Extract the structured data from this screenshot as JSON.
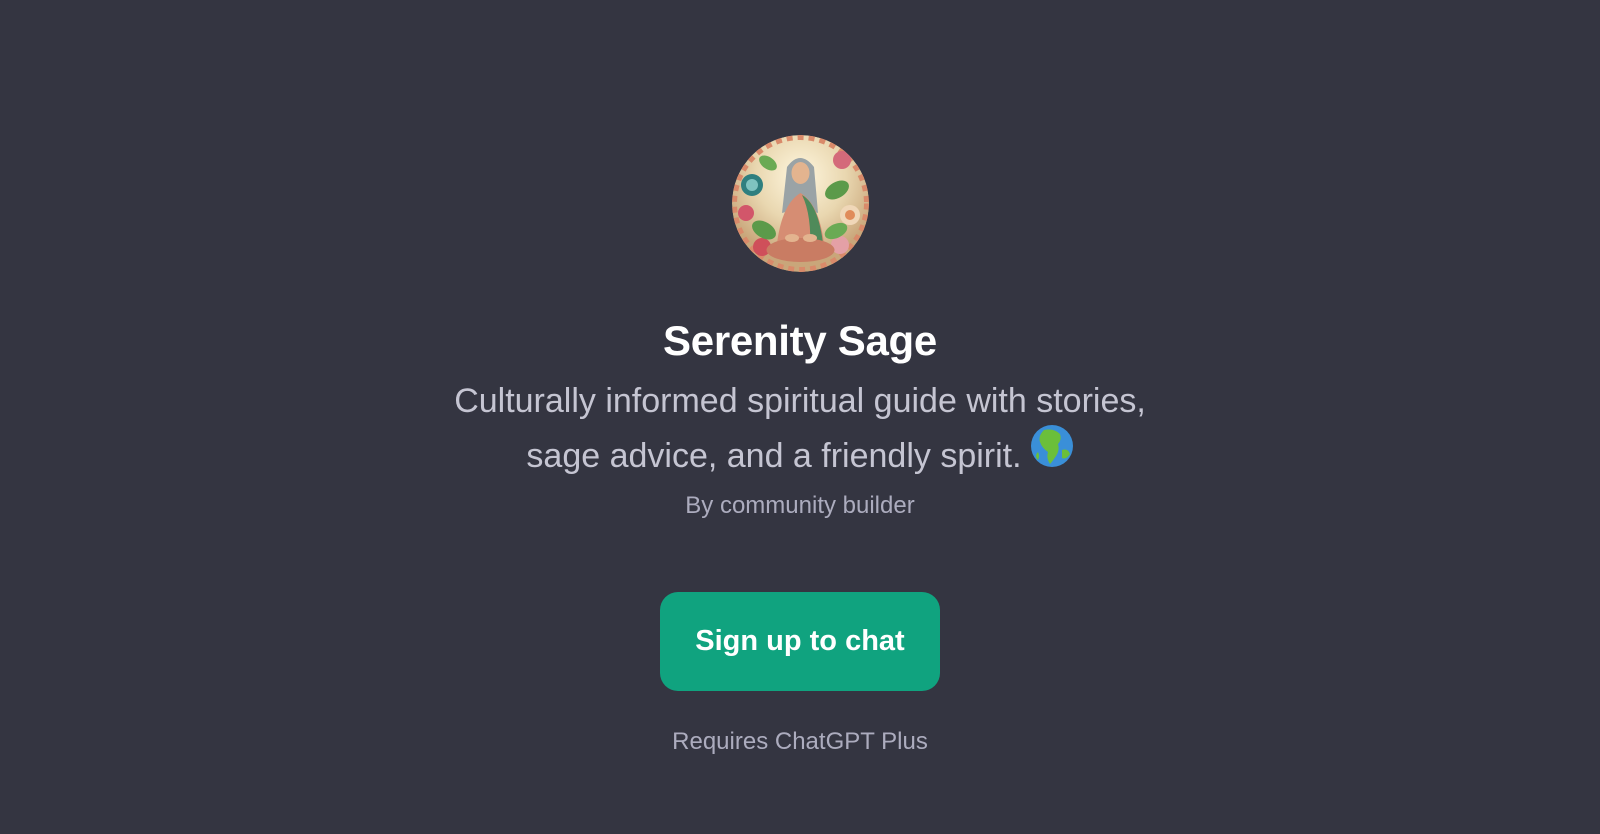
{
  "gpt": {
    "name": "Serenity Sage",
    "description_line1": "Culturally informed spiritual guide with stories,",
    "description_line2": "sage advice, and a friendly spirit.",
    "description_emoji_icon": "globe-europe-africa-icon",
    "author": "By community builder"
  },
  "cta": {
    "label": "Sign up to chat",
    "note": "Requires ChatGPT Plus"
  },
  "colors": {
    "background": "#343541",
    "title": "#ffffff",
    "description": "#c5c5d2",
    "muted": "#acacbe",
    "accent": "#10a37f"
  }
}
